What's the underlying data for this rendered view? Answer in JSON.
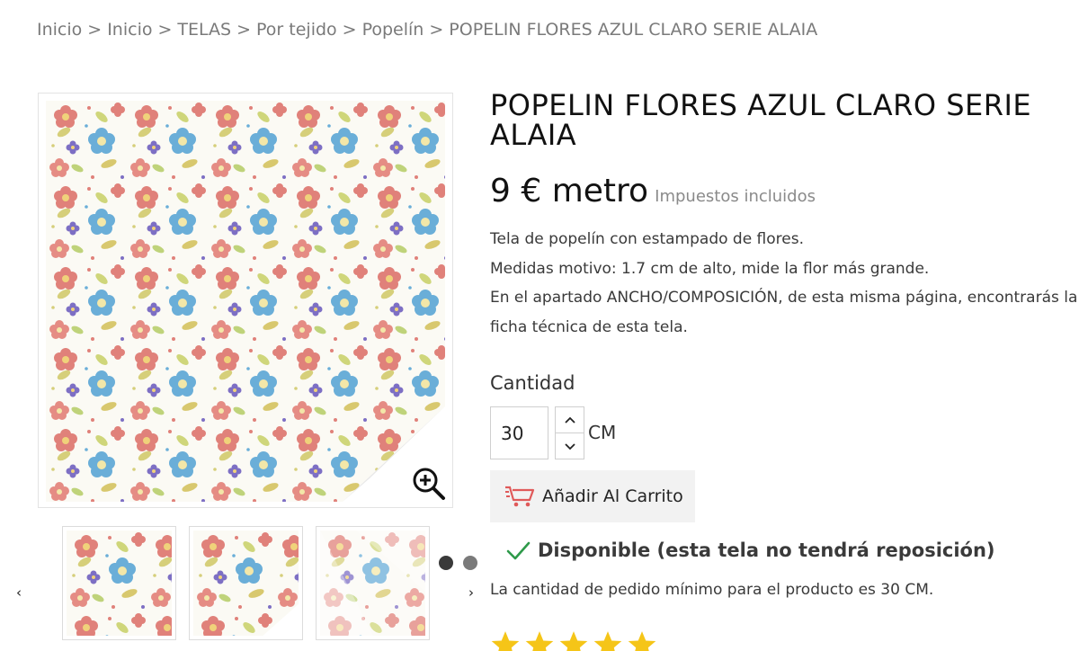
{
  "breadcrumb": {
    "items": [
      "Inicio",
      "Inicio",
      "TELAS",
      "Por tejido",
      "Popelín",
      "POPELIN FLORES AZUL CLARO SERIE ALAIA"
    ],
    "separator": ">"
  },
  "product": {
    "title": "POPELIN FLORES AZUL CLARO SERIE ALAIA",
    "price": "9 € metro",
    "tax_label": "Impuestos incluidos",
    "description": [
      "Tela de popelín con estampado de flores.",
      "Medidas motivo: 1.7 cm de alto, mide la flor más grande.",
      "En el apartado ANCHO/COMPOSICIÓN, de esta misma página, encontrarás la",
      "ficha técnica de esta tela."
    ]
  },
  "quantity": {
    "label": "Cantidad",
    "value": "30",
    "unit": "CM"
  },
  "cart": {
    "add_label": "Añadir Al Carrito"
  },
  "availability": {
    "text": "Disponible (esta tela no tendrá reposición)",
    "min_order": "La cantidad de pedido mínimo para el producto es 30 CM."
  },
  "gallery": {
    "thumbnail_count": 3,
    "active_dot": 0,
    "dots": 2
  },
  "rating": {
    "stars": 5,
    "max": 5
  },
  "colors": {
    "accent_red": "#e05a5a",
    "check_green": "#2e9a4a",
    "star_gold": "#f5c518",
    "dot_active": "#3a3a3a",
    "dot_inactive": "#7a7a7a"
  },
  "icons": {
    "zoom": "zoom-in-icon",
    "cart": "cart-icon",
    "check": "check-icon",
    "prev": "chevron-left-icon",
    "next": "chevron-right-icon",
    "up": "chevron-up-icon",
    "down": "chevron-down-icon",
    "star": "star-icon"
  }
}
